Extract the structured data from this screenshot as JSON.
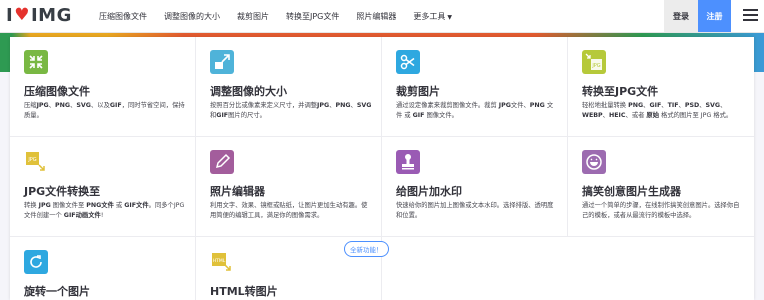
{
  "nav": {
    "logo_left": "I",
    "logo_right": "IMG",
    "menu": [
      {
        "label": "压缩图像文件"
      },
      {
        "label": "调整图像的大小"
      },
      {
        "label": "裁剪图片"
      },
      {
        "label": "转换至JPG文件"
      },
      {
        "label": "照片编辑器"
      },
      {
        "label": "更多工具"
      }
    ],
    "login": "登录",
    "signup": "注册"
  },
  "colors": {
    "brand_red": "#e5322d",
    "signup_blue": "#4d90fe"
  },
  "tools": [
    {
      "title": "压缩图像文件",
      "icon": "compress-icon",
      "color": "#79b843",
      "desc": [
        "压缩",
        {
          "b": "JPG"
        },
        "、",
        {
          "b": "PNG"
        },
        "、",
        {
          "b": "SVG"
        },
        "、以及",
        {
          "b": "GIF"
        },
        "，同时节省空间，保持质量。"
      ]
    },
    {
      "title": "调整图像的大小",
      "icon": "resize-icon",
      "color": "#4fb3d9",
      "desc": [
        "按照百分比或像素来定义尺寸，并调整",
        {
          "b": "JPG"
        },
        "、",
        {
          "b": "PNG"
        },
        "、",
        {
          "b": "SVG"
        },
        "和",
        {
          "b": "GIF"
        },
        "图片的尺寸。"
      ]
    },
    {
      "title": "裁剪图片",
      "icon": "scissors-icon",
      "color": "#2ea8e0",
      "desc": [
        "通过设定像素来裁剪图像文件。裁剪 ",
        {
          "b": "JPG"
        },
        "文件、",
        {
          "b": "PNG"
        },
        " 文件 或 ",
        {
          "b": "GIF"
        },
        " 图像文件。"
      ]
    },
    {
      "title": "转换至JPG文件",
      "icon": "convert-to-jpg-icon",
      "color": "#b6c93a",
      "desc": [
        "轻松地批量转换 ",
        {
          "b": "PNG"
        },
        "、",
        {
          "b": "GIF"
        },
        "、",
        {
          "b": "TIF"
        },
        "、",
        {
          "b": "PSD"
        },
        "、",
        {
          "b": "SVG"
        },
        "、",
        {
          "b": "WEBP"
        },
        "、",
        {
          "b": "HEIC"
        },
        "、或者 ",
        {
          "b": "原始"
        },
        " 格式的图片至 JPG 格式。"
      ]
    },
    {
      "title": "JPG文件转换至",
      "icon": "convert-from-jpg-icon",
      "color": "#e0c13a",
      "desc": [
        "转换 ",
        {
          "b": "JPG"
        },
        " 图像文件至 ",
        {
          "b": "PNG文件"
        },
        " 或 ",
        {
          "b": "GIF文件"
        },
        "。同多个JPG文件创建一个 ",
        {
          "b": "GIF动画文件"
        },
        "!"
      ]
    },
    {
      "title": "照片编辑器",
      "icon": "pencil-icon",
      "color": "#a35d9c",
      "desc": [
        "利用文字、效果、镜框或贴纸，让图片更加生动有趣。使用简便的编辑工具，满足你的图像需求。"
      ]
    },
    {
      "title": "给图片加水印",
      "icon": "stamp-icon",
      "color": "#9a5bb4",
      "desc": [
        "快速给你的图片加上图像或文本水印。选择排版、透明度和位置。"
      ]
    },
    {
      "title": "搞笑创意图片生成器",
      "icon": "laugh-icon",
      "color": "#9c6bb0",
      "desc": [
        "通过一个简单的步骤，在线制作搞笑创意图片。选择你自己的模板，或者从最流行的模板中选择。"
      ]
    },
    {
      "title": "旋转一个图片",
      "icon": "rotate-icon",
      "color": "#2ea8e0",
      "desc": []
    },
    {
      "title": "HTML转图片",
      "icon": "html-icon",
      "color": "#e0c13a",
      "desc": [],
      "badge": "全新功能！"
    }
  ]
}
